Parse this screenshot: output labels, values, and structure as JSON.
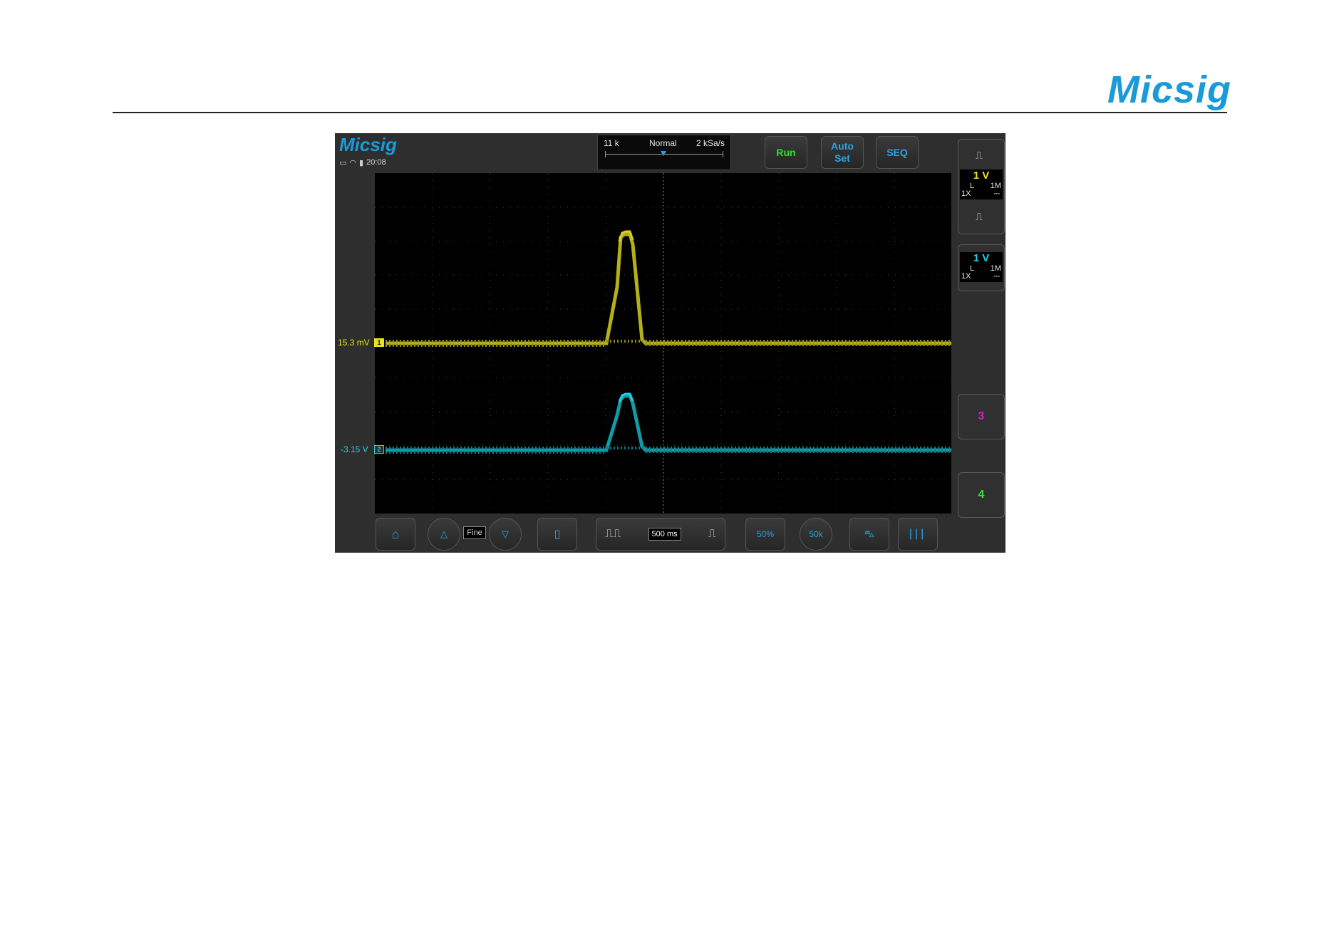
{
  "header": {
    "brand": "Micsig"
  },
  "scope": {
    "brand": "Micsig",
    "time": "20:08",
    "acquisition": {
      "memory": "11 k",
      "mode": "Normal",
      "sample_rate": "2 kSa/s"
    },
    "buttons": {
      "run": "Run",
      "auto_line1": "Auto",
      "auto_line2": "Set",
      "seq": "SEQ"
    },
    "channels": [
      {
        "id": "1",
        "scale": "1 V",
        "coupling": "L",
        "impedance": "1M",
        "probe": "1X",
        "dc_symbol": "⎓",
        "level": "15.3 mV",
        "color": "#e8e21a"
      },
      {
        "id": "2",
        "scale": "1 V",
        "coupling": "L",
        "impedance": "1M",
        "probe": "1X",
        "dc_symbol": "⎓",
        "level": "-3.15 V",
        "color": "#1ed3e3"
      },
      {
        "id": "3",
        "color": "#d21ad6"
      },
      {
        "id": "4",
        "color": "#35e03a"
      }
    ],
    "bottom": {
      "fine": "Fine",
      "timebase": "500 ms",
      "fifty": "50%",
      "auto_mini": "50k"
    },
    "icons": [
      "home-icon",
      "arrow-up-icon",
      "arrow-down-icon",
      "save-icon",
      "pulse-wide-icon",
      "pulse-narrow-icon",
      "car-icon",
      "cursor-icon",
      "screen-icon",
      "wifi-icon",
      "battery-icon"
    ],
    "colors": {
      "accent": "#2aa4e0",
      "run": "#2ee02e",
      "background": "#2e2e2e",
      "grid": "#4a4a4a"
    }
  }
}
